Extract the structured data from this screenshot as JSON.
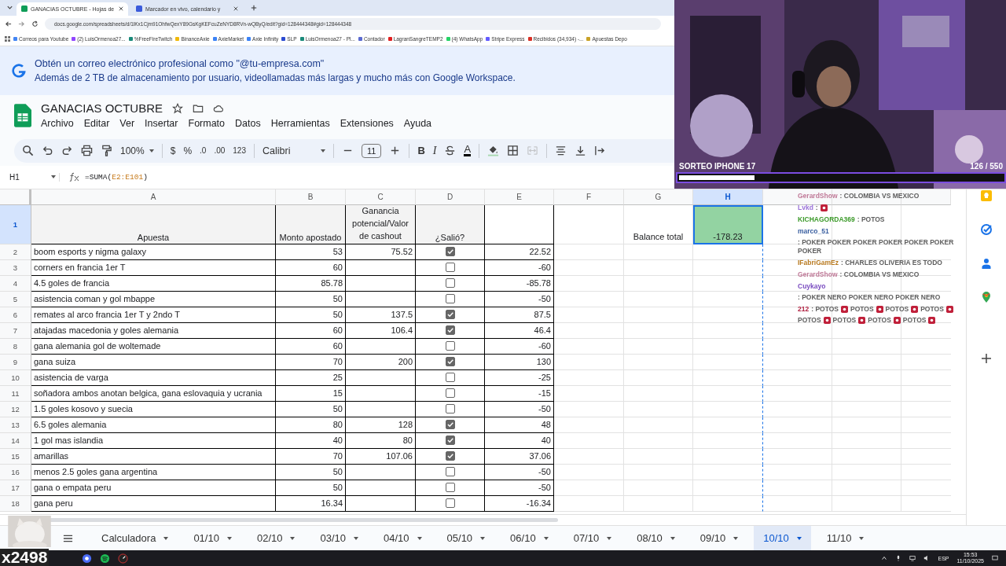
{
  "browser": {
    "tabs": [
      {
        "title": "GANACIAS OCTUBRE - Hojas de",
        "selected": true
      },
      {
        "title": "Marcador en vivo, calendario y",
        "selected": false
      }
    ],
    "url": "docs.google.com/spreadsheets/d/1lKx1Cjm91OhfwQexY89GsKgKEFcuZeNYD8RVn-wQByQ/edit?gid=128444348#gid=128444348",
    "bookmarks": [
      {
        "label": "Correos para Youtube",
        "color": "#4285f4"
      },
      {
        "label": "(2) LuisOrmenoa27...",
        "color": "#9146ff"
      },
      {
        "label": "%FreeFireTwitch",
        "color": "#1a8a7a"
      },
      {
        "label": "BinanceAxie",
        "color": "#f0b90b"
      },
      {
        "label": "AxieMarket",
        "color": "#3b82f6"
      },
      {
        "label": "Axie Infinity",
        "color": "#3b82f6"
      },
      {
        "label": "SLP",
        "color": "#2b4bd1"
      },
      {
        "label": "LuisOrmenoa27 - Pl...",
        "color": "#1a8a7a"
      },
      {
        "label": "Contador",
        "color": "#5a6ad0"
      },
      {
        "label": "LagranSangreTEMP2",
        "color": "#e02020"
      },
      {
        "label": "(4) WhatsApp",
        "color": "#25d366"
      },
      {
        "label": "Stripe Express",
        "color": "#635bff"
      },
      {
        "label": "Recibidos (34,934) -...",
        "color": "#d93025"
      },
      {
        "label": "Apuestas Depo",
        "color": "#c9a227"
      }
    ]
  },
  "banner": {
    "title": "Obtén un correo electrónico profesional como \"@tu-empresa.com\"",
    "text": "Además de 2 TB de almacenamiento por usuario, videollamadas más largas y mucho más con Google Workspace."
  },
  "document": {
    "title": "GANACIAS OCTUBRE",
    "menu": [
      "Archivo",
      "Editar",
      "Ver",
      "Insertar",
      "Formato",
      "Datos",
      "Herramientas",
      "Extensiones",
      "Ayuda"
    ]
  },
  "toolbar": {
    "zoom": "100%",
    "currency": "$",
    "percent": "%",
    "decrease_decimals": ".0",
    "increase_decimals": ".00",
    "number_format": "123",
    "font": "Calibri",
    "font_size": "11",
    "bold": "B",
    "italic": "I",
    "text_color": "A"
  },
  "formula_bar": {
    "cell": "H1",
    "formula": [
      {
        "text": "=SUMA(",
        "kind": "plain"
      },
      {
        "text": "E2:E101",
        "kind": "ref"
      },
      {
        "text": ")",
        "kind": "plain"
      }
    ]
  },
  "sheet": {
    "columns": [
      "A",
      "B",
      "C",
      "D",
      "E",
      "F",
      "G",
      "H"
    ],
    "header": {
      "num": "1",
      "apuesta": "Apuesta",
      "monto": "Monto apostado",
      "ganancia": "Ganancia potencial/Valor de cashout",
      "salio": "¿Salió?"
    },
    "balance": {
      "label": "Balance total",
      "value": "-178.23",
      "selected": true
    },
    "rows": [
      {
        "num": "2",
        "apuesta": "boom esports y nigma galaxy",
        "monto": "53",
        "ganancia": "75.52",
        "checked": true,
        "resultado": "22.52"
      },
      {
        "num": "3",
        "apuesta": "corners en francia 1er T",
        "monto": "60",
        "checked": false,
        "resultado": "-60"
      },
      {
        "num": "4",
        "apuesta": "4.5 goles de francia",
        "monto": "85.78",
        "checked": false,
        "resultado": "-85.78"
      },
      {
        "num": "5",
        "apuesta": "asistencia coman y gol mbappe",
        "monto": "50",
        "checked": false,
        "resultado": "-50"
      },
      {
        "num": "6",
        "apuesta": "remates al arco francia 1er T y 2ndo T",
        "monto": "50",
        "ganancia": "137.5",
        "checked": true,
        "resultado": "87.5"
      },
      {
        "num": "7",
        "apuesta": "atajadas macedonia y goles alemania",
        "monto": "60",
        "ganancia": "106.4",
        "checked": true,
        "resultado": "46.4"
      },
      {
        "num": "8",
        "apuesta": "gana alemania gol de woltemade",
        "monto": "60",
        "checked": false,
        "resultado": "-60"
      },
      {
        "num": "9",
        "apuesta": "gana suiza",
        "monto": "70",
        "ganancia": "200",
        "checked": true,
        "resultado": "130"
      },
      {
        "num": "10",
        "apuesta": "asistencia de varga",
        "monto": "25",
        "checked": false,
        "resultado": "-25"
      },
      {
        "num": "11",
        "apuesta": "soñadora ambos anotan belgica, gana eslovaquia y ucrania",
        "monto": "15",
        "checked": false,
        "resultado": "-15"
      },
      {
        "num": "12",
        "apuesta": "1.5 goles kosovo y suecia",
        "monto": "50",
        "checked": false,
        "resultado": "-50"
      },
      {
        "num": "13",
        "apuesta": "6.5 goles alemania",
        "monto": "80",
        "ganancia": "128",
        "checked": true,
        "resultado": "48"
      },
      {
        "num": "14",
        "apuesta": "1 gol mas islandia",
        "monto": "40",
        "ganancia": "80",
        "checked": true,
        "resultado": "40"
      },
      {
        "num": "15",
        "apuesta": "amarillas",
        "monto": "70",
        "ganancia": "107.06",
        "checked": true,
        "resultado": "37.06"
      },
      {
        "num": "16",
        "apuesta": "menos 2.5 goles gana argentina",
        "monto": "50",
        "checked": false,
        "resultado": "-50"
      },
      {
        "num": "17",
        "apuesta": "gana o empata peru",
        "monto": "50",
        "checked": false,
        "resultado": "-50"
      },
      {
        "num": "18",
        "apuesta": "gana peru",
        "monto": "16.34",
        "checked": false,
        "resultado": "-16.34"
      }
    ]
  },
  "sheet_tabs": [
    {
      "label": "Calculadora",
      "selected": false
    },
    {
      "label": "01/10",
      "selected": false
    },
    {
      "label": "02/10",
      "selected": false
    },
    {
      "label": "03/10",
      "selected": false
    },
    {
      "label": "04/10",
      "selected": false
    },
    {
      "label": "05/10",
      "selected": false
    },
    {
      "label": "06/10",
      "selected": false
    },
    {
      "label": "07/10",
      "selected": false
    },
    {
      "label": "08/10",
      "selected": false
    },
    {
      "label": "09/10",
      "selected": false
    },
    {
      "label": "10/10",
      "selected": true
    },
    {
      "label": "11/10",
      "selected": false
    }
  ],
  "stream": {
    "goal_title": "SORTEO IPHONE 17",
    "goal_count": "126  / 550",
    "level": 0.23,
    "sticker_count": "x2498",
    "chat": [
      {
        "user": "GerardShow",
        "color": "#c07a98",
        "parts": [
          {
            "text": ": COLOMBIA VS MEXICO",
            "emote": false
          }
        ]
      },
      {
        "user": "Lvkd",
        "color": "#9a72d8",
        "parts": [
          {
            "text": ":",
            "emote": true
          }
        ]
      },
      {
        "user": "KICHAGORDA369",
        "color": "#3c9a2a",
        "parts": [
          {
            "text": ": POTOS",
            "emote": false
          }
        ]
      },
      {
        "user": "marco_51",
        "color": "#3a5fa0",
        "parts": [
          {
            "text": ": POKER POKER POKER POKER POKER POKER POKER",
            "emote": false
          }
        ]
      },
      {
        "user": "IFabriGamEz",
        "color": "#b87a20",
        "parts": [
          {
            "text": ": CHARLES OLIVERIA ES TODO",
            "emote": false
          }
        ]
      },
      {
        "user": "GerardShow",
        "color": "#c07a98",
        "parts": [
          {
            "text": ": COLOMBIA VS MEXICO",
            "emote": false
          }
        ]
      },
      {
        "user": "Cuykayo",
        "color": "#7a4cc0",
        "parts": [
          {
            "text": ": POKER NERO POKER NERO POKER NERO",
            "emote": false
          }
        ]
      },
      {
        "user": "212",
        "color": "#b02040",
        "parts": [
          {
            "text": ": POTOS",
            "emote": true
          },
          {
            "text": "POTOS",
            "emote": true
          },
          {
            "text": "POTOS",
            "emote": true
          },
          {
            "text": "POTOS",
            "emote": true
          },
          {
            "text": "POTOS",
            "emote": true
          },
          {
            "text": "POTOS",
            "emote": true
          },
          {
            "text": "POTOS",
            "emote": true
          },
          {
            "text": "POTOS",
            "emote": true
          }
        ]
      }
    ]
  },
  "taskbar": {
    "language": "ESP",
    "time": "15:53",
    "date": "11/10/2025"
  }
}
